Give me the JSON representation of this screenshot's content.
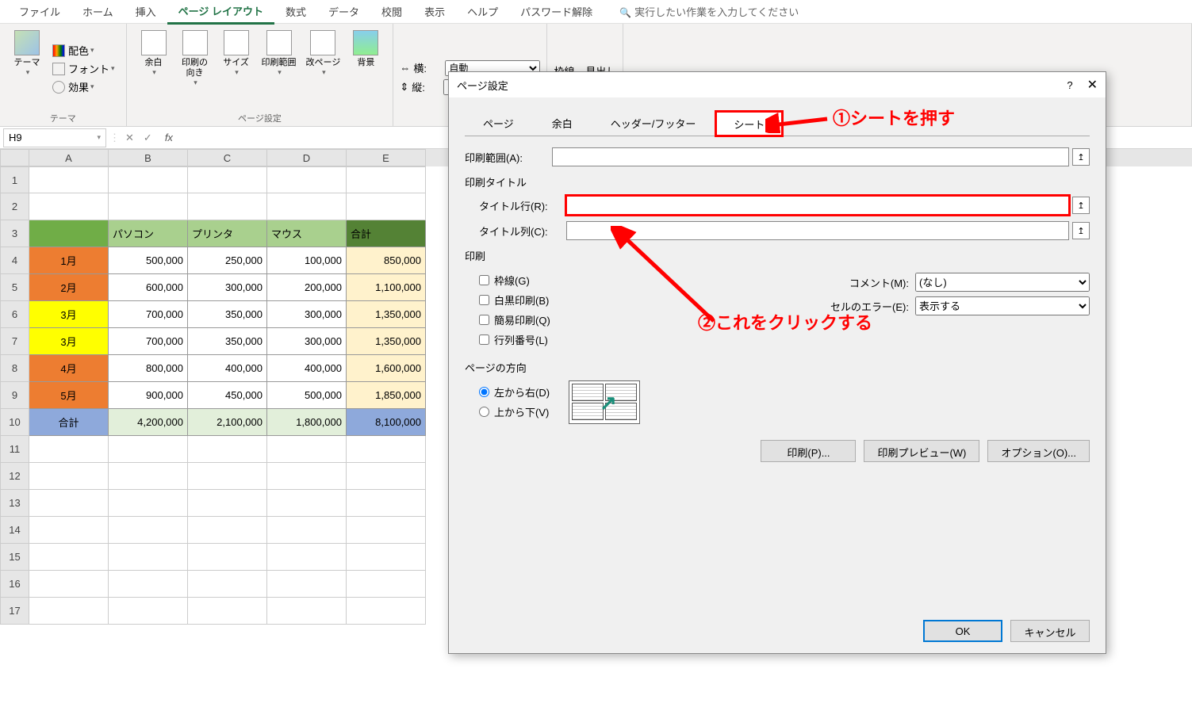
{
  "menu": {
    "file": "ファイル",
    "home": "ホーム",
    "insert": "挿入",
    "pagelayout": "ページ レイアウト",
    "formulas": "数式",
    "data": "データ",
    "review": "校閲",
    "view": "表示",
    "help": "ヘルプ",
    "passunlock": "パスワード解除",
    "search_ph": "実行したい作業を入力してください"
  },
  "ribbon": {
    "theme_group": "テーマ",
    "themes": "テーマ",
    "colors": "配色",
    "fonts": "フォント",
    "effects": "効果",
    "pagesetup_group": "ページ設定",
    "margins": "余白",
    "orientation": "印刷の\n向き",
    "size": "サイズ",
    "printarea": "印刷範囲",
    "breaks": "改ページ",
    "background": "背景",
    "scale_width_lbl": "横:",
    "scale_height_lbl": "縦:",
    "scale_auto": "自動",
    "gridlines": "枠線",
    "headings": "見出し"
  },
  "formula": {
    "namebox": "H9"
  },
  "columns": [
    "A",
    "B",
    "C",
    "D",
    "E"
  ],
  "table": {
    "headers": {
      "col_b": "パソコン",
      "col_c": "プリンタ",
      "col_d": "マウス",
      "col_e": "合計"
    },
    "rows": [
      {
        "m": "1月",
        "b": "500,000",
        "c": "250,000",
        "d": "100,000",
        "e": "850,000"
      },
      {
        "m": "2月",
        "b": "600,000",
        "c": "300,000",
        "d": "200,000",
        "e": "1,100,000"
      },
      {
        "m": "3月",
        "b": "700,000",
        "c": "350,000",
        "d": "300,000",
        "e": "1,350,000"
      },
      {
        "m": "3月",
        "b": "700,000",
        "c": "350,000",
        "d": "300,000",
        "e": "1,350,000"
      },
      {
        "m": "4月",
        "b": "800,000",
        "c": "400,000",
        "d": "400,000",
        "e": "1,600,000"
      },
      {
        "m": "5月",
        "b": "900,000",
        "c": "450,000",
        "d": "500,000",
        "e": "1,850,000"
      }
    ],
    "total": {
      "lbl": "合計",
      "b": "4,200,000",
      "c": "2,100,000",
      "d": "1,800,000",
      "e": "8,100,000"
    }
  },
  "dialog": {
    "title": "ページ設定",
    "help": "?",
    "close": "✕",
    "tab_page": "ページ",
    "tab_margins": "余白",
    "tab_hf": "ヘッダー/フッター",
    "tab_sheet": "シート",
    "print_area_lbl": "印刷範囲(A):",
    "print_titles": "印刷タイトル",
    "title_rows_lbl": "タイトル行(R):",
    "title_cols_lbl": "タイトル列(C):",
    "print_section": "印刷",
    "cb_gridlines": "枠線(G)",
    "cb_bw": "白黒印刷(B)",
    "cb_draft": "簡易印刷(Q)",
    "cb_rowcol": "行列番号(L)",
    "comments_lbl": "コメント(M):",
    "comments_val": "(なし)",
    "errors_lbl": "セルのエラー(E):",
    "errors_val": "表示する",
    "page_order": "ページの方向",
    "r_ltr": "左から右(D)",
    "r_ttb": "上から下(V)",
    "btn_print": "印刷(P)...",
    "btn_preview": "印刷プレビュー(W)",
    "btn_options": "オプション(O)...",
    "btn_ok": "OK",
    "btn_cancel": "キャンセル"
  },
  "annot": {
    "a1": "①シートを押す",
    "a2": "②これをクリックする"
  }
}
